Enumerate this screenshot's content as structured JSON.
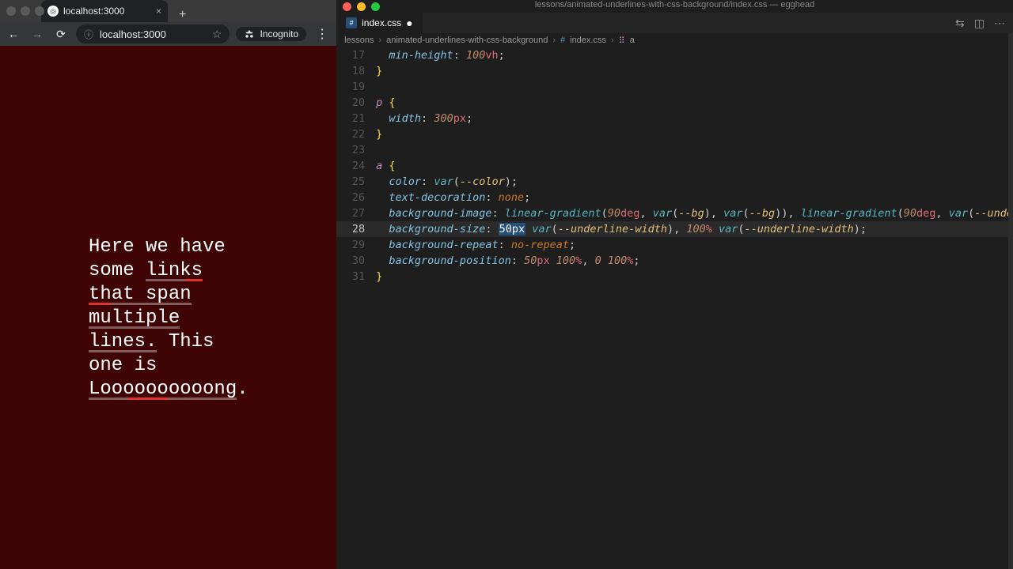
{
  "browser": {
    "tab_title": "localhost:3000",
    "omnibox_url": "localhost:3000",
    "incognito_label": "Incognito",
    "page_text": {
      "t1": "Here we have some ",
      "link1": "links that span multiple lines.",
      "t2": " This one is ",
      "link2": "Loooooooooong",
      "t3": "."
    }
  },
  "editor": {
    "window_title": "lessons/animated-underlines-with-css-background/index.css — egghead",
    "tab_label": "index.css",
    "breadcrumb": {
      "folder1": "lessons",
      "folder2": "animated-underlines-with-css-background",
      "file": "index.css",
      "symbol": "a"
    },
    "lines": [
      {
        "n": "17",
        "segs": [
          [
            "pad",
            "  "
          ],
          [
            "prop",
            "min-height"
          ],
          [
            "pun",
            ": "
          ],
          [
            "num",
            "100"
          ],
          [
            "unit",
            "vh"
          ],
          [
            "pun",
            ";"
          ]
        ]
      },
      {
        "n": "18",
        "segs": [
          [
            "brace",
            "}"
          ]
        ]
      },
      {
        "n": "19",
        "segs": []
      },
      {
        "n": "20",
        "segs": [
          [
            "sel",
            "p"
          ],
          [
            "pun",
            " "
          ],
          [
            "brace",
            "{"
          ]
        ]
      },
      {
        "n": "21",
        "segs": [
          [
            "pad",
            "  "
          ],
          [
            "prop",
            "width"
          ],
          [
            "pun",
            ": "
          ],
          [
            "num",
            "300"
          ],
          [
            "unit",
            "px"
          ],
          [
            "pun",
            ";"
          ]
        ]
      },
      {
        "n": "22",
        "segs": [
          [
            "brace",
            "}"
          ]
        ]
      },
      {
        "n": "23",
        "segs": []
      },
      {
        "n": "24",
        "segs": [
          [
            "sel",
            "a"
          ],
          [
            "pun",
            " "
          ],
          [
            "brace",
            "{"
          ]
        ]
      },
      {
        "n": "25",
        "segs": [
          [
            "pad",
            "  "
          ],
          [
            "prop",
            "color"
          ],
          [
            "pun",
            ": "
          ],
          [
            "fn",
            "var"
          ],
          [
            "pun",
            "("
          ],
          [
            "varn",
            "--color"
          ],
          [
            "pun",
            ")"
          ],
          [
            "pun",
            ";"
          ]
        ]
      },
      {
        "n": "26",
        "segs": [
          [
            "pad",
            "  "
          ],
          [
            "prop",
            "text-decoration"
          ],
          [
            "pun",
            ": "
          ],
          [
            "kw",
            "none"
          ],
          [
            "pun",
            ";"
          ]
        ]
      },
      {
        "n": "27",
        "segs": [
          [
            "pad",
            "  "
          ],
          [
            "prop",
            "background-image"
          ],
          [
            "pun",
            ": "
          ],
          [
            "fn",
            "linear-gradient"
          ],
          [
            "pun",
            "("
          ],
          [
            "num",
            "90"
          ],
          [
            "unit",
            "deg"
          ],
          [
            "pun",
            ", "
          ],
          [
            "fn",
            "var"
          ],
          [
            "pun",
            "("
          ],
          [
            "varn",
            "--bg"
          ],
          [
            "pun",
            "), "
          ],
          [
            "fn",
            "var"
          ],
          [
            "pun",
            "("
          ],
          [
            "varn",
            "--bg"
          ],
          [
            "pun",
            ")), "
          ],
          [
            "fn",
            "linear-gradient"
          ],
          [
            "pun",
            "("
          ],
          [
            "num",
            "90"
          ],
          [
            "unit",
            "deg"
          ],
          [
            "pun",
            ", "
          ],
          [
            "fn",
            "var"
          ],
          [
            "pun",
            "("
          ],
          [
            "varn",
            "--unde"
          ]
        ]
      },
      {
        "n": "28",
        "current": true,
        "segs": [
          [
            "pad",
            "  "
          ],
          [
            "prop",
            "background-size"
          ],
          [
            "pun",
            ": "
          ],
          [
            "hl",
            "50px"
          ],
          [
            "pun",
            " "
          ],
          [
            "fn",
            "var"
          ],
          [
            "pun",
            "("
          ],
          [
            "varn",
            "--underline-width"
          ],
          [
            "pun",
            "), "
          ],
          [
            "num",
            "100"
          ],
          [
            "unit",
            "%"
          ],
          [
            "pun",
            " "
          ],
          [
            "fn",
            "var"
          ],
          [
            "pun",
            "("
          ],
          [
            "varn",
            "--underline-width"
          ],
          [
            "pun",
            ")"
          ],
          [
            "pun",
            ";"
          ]
        ]
      },
      {
        "n": "29",
        "segs": [
          [
            "pad",
            "  "
          ],
          [
            "prop",
            "background-repeat"
          ],
          [
            "pun",
            ": "
          ],
          [
            "kw",
            "no-repeat"
          ],
          [
            "pun",
            ";"
          ]
        ]
      },
      {
        "n": "30",
        "segs": [
          [
            "pad",
            "  "
          ],
          [
            "prop",
            "background-position"
          ],
          [
            "pun",
            ": "
          ],
          [
            "num",
            "50"
          ],
          [
            "unit",
            "px"
          ],
          [
            "pun",
            " "
          ],
          [
            "num",
            "100"
          ],
          [
            "unit",
            "%"
          ],
          [
            "pun",
            ", "
          ],
          [
            "num",
            "0"
          ],
          [
            "pun",
            " "
          ],
          [
            "num",
            "100"
          ],
          [
            "unit",
            "%"
          ],
          [
            "pun",
            ";"
          ]
        ]
      },
      {
        "n": "31",
        "segs": [
          [
            "brace",
            "}"
          ]
        ]
      }
    ]
  },
  "traffic_colors": {
    "red": "#ff5f57",
    "yellow": "#febc2e",
    "green": "#28c840"
  }
}
